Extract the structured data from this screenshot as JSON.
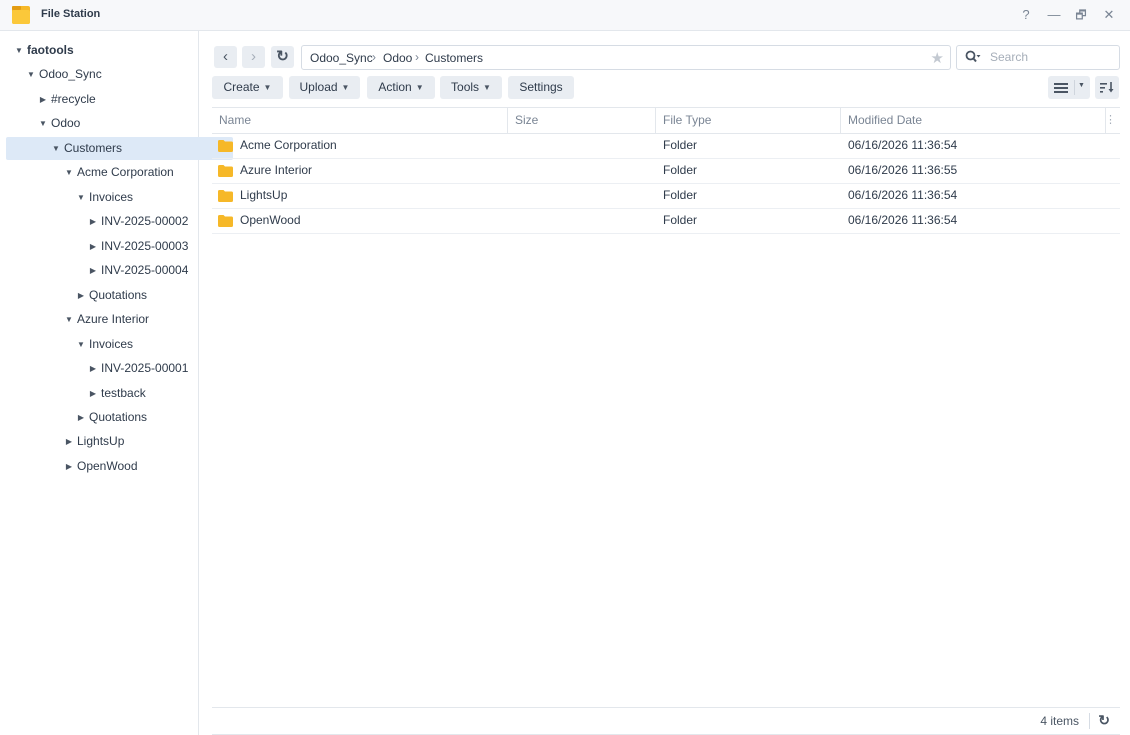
{
  "app": {
    "title": "File Station"
  },
  "window_controls": {
    "help": "?",
    "minimize": "—",
    "restore": "🗗",
    "close": "✕"
  },
  "sidebar": {
    "items": [
      {
        "label": "faotools",
        "state": "expanded"
      },
      {
        "label": "Odoo_Sync",
        "state": "expanded"
      },
      {
        "label": "#recycle",
        "state": "collapsed"
      },
      {
        "label": "Odoo",
        "state": "expanded"
      },
      {
        "label": "Customers",
        "state": "expanded",
        "selected": true
      },
      {
        "label": "Acme Corporation",
        "state": "expanded"
      },
      {
        "label": "Invoices",
        "state": "expanded"
      },
      {
        "label": "INV-2025-00002",
        "state": "collapsed"
      },
      {
        "label": "INV-2025-00003",
        "state": "collapsed"
      },
      {
        "label": "INV-2025-00004",
        "state": "collapsed"
      },
      {
        "label": "Quotations",
        "state": "collapsed"
      },
      {
        "label": "Azure Interior",
        "state": "expanded"
      },
      {
        "label": "Invoices",
        "state": "expanded"
      },
      {
        "label": "INV-2025-00001",
        "state": "collapsed"
      },
      {
        "label": "testback",
        "state": "collapsed"
      },
      {
        "label": "Quotations",
        "state": "collapsed"
      },
      {
        "label": "LightsUp",
        "state": "collapsed"
      },
      {
        "label": "OpenWood",
        "state": "collapsed"
      }
    ]
  },
  "nav": {
    "back": "‹",
    "forward": "›",
    "refresh": "↻"
  },
  "breadcrumb": {
    "parts": [
      "Odoo_Sync",
      "Odoo",
      "Customers"
    ],
    "separator": "›"
  },
  "search": {
    "placeholder": "Search",
    "value": ""
  },
  "toolbar": {
    "create": "Create",
    "upload": "Upload",
    "action": "Action",
    "tools": "Tools",
    "settings": "Settings"
  },
  "table": {
    "columns": [
      "Name",
      "Size",
      "File Type",
      "Modified Date"
    ],
    "rows": [
      {
        "name": "Acme Corporation",
        "size": "",
        "type": "Folder",
        "modified": "06/16/2026 11:36:54"
      },
      {
        "name": "Azure Interior",
        "size": "",
        "type": "Folder",
        "modified": "06/16/2026 11:36:55"
      },
      {
        "name": "LightsUp",
        "size": "",
        "type": "Folder",
        "modified": "06/16/2026 11:36:54"
      },
      {
        "name": "OpenWood",
        "size": "",
        "type": "Folder",
        "modified": "06/16/2026 11:36:54"
      }
    ]
  },
  "status": {
    "count": "4 items"
  },
  "colors": {
    "accent": "#0086e5",
    "folder": "#f6b828",
    "selected_bg": "#dde9f7",
    "button_bg": "#e9edf2"
  }
}
